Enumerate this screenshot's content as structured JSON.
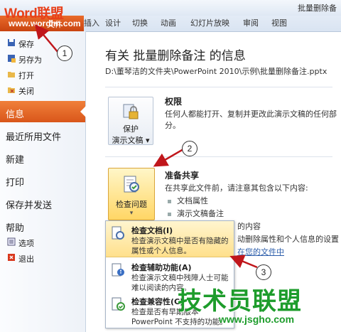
{
  "window": {
    "title": "批量删除备"
  },
  "ribbon": {
    "file_label": "文件",
    "tabs": [
      "插入",
      "设计",
      "切换",
      "动画",
      "幻灯片放映",
      "审阅",
      "视图"
    ]
  },
  "watermark": {
    "brand": "Word联盟",
    "url": "www.wordlm.com",
    "big": "技术员联盟",
    "big_url": "www.jsgho.com"
  },
  "sidebar": {
    "small_items": [
      {
        "icon": "save-icon",
        "label": "保存"
      },
      {
        "icon": "save-as-icon",
        "label": "另存为"
      },
      {
        "icon": "open-folder-icon",
        "label": "打开"
      },
      {
        "icon": "close-folder-icon",
        "label": "关闭"
      }
    ],
    "big_items": [
      "信息",
      "最近所用文件",
      "新建",
      "打印",
      "保存并发送",
      "帮助"
    ],
    "bottom_items": [
      {
        "icon": "options-icon",
        "label": "选项"
      },
      {
        "icon": "exit-icon",
        "label": "退出"
      }
    ],
    "selected": "信息"
  },
  "main": {
    "title": "有关 批量删除备注 的信息",
    "path": "D:\\董琴洁的文件夹\\PowerPoint 2010\\示例\\批量删除备注.pptx",
    "permissions": {
      "button_line1": "保护",
      "button_line2": "演示文稿",
      "heading": "权限",
      "desc": "任何人都能打开、复制并更改此演示文稿的任何部分。"
    },
    "prepare": {
      "button_label": "检查问题",
      "heading": "准备共享",
      "desc": "在共享此文件前，请注意其包含以下内容:",
      "bullets": [
        "文档属性",
        "演示文稿备注"
      ],
      "right_frag1": "的内容",
      "right_frag2": "动删除属性和个人信息的设置",
      "right_link": "在您的文件中"
    }
  },
  "menu": {
    "items": [
      {
        "icon": "inspect-document-icon",
        "title": "检查文档(I)",
        "desc": "检查演示文稿中是否有隐藏的属性或个人信息。"
      },
      {
        "icon": "accessibility-check-icon",
        "title": "检查辅助功能(A)",
        "desc": "检查演示文稿中残障人士可能难以阅读的内容。"
      },
      {
        "icon": "compatibility-check-icon",
        "title": "检查兼容性(C)",
        "desc": "检查是否有早期版本PowerPoint 不支持的功能。"
      }
    ]
  },
  "callouts": [
    "1",
    "2",
    "3"
  ],
  "colors": {
    "accent": "#d9561a",
    "highlight": "#ffe08c",
    "watermark_green": "#1d9c2b"
  }
}
